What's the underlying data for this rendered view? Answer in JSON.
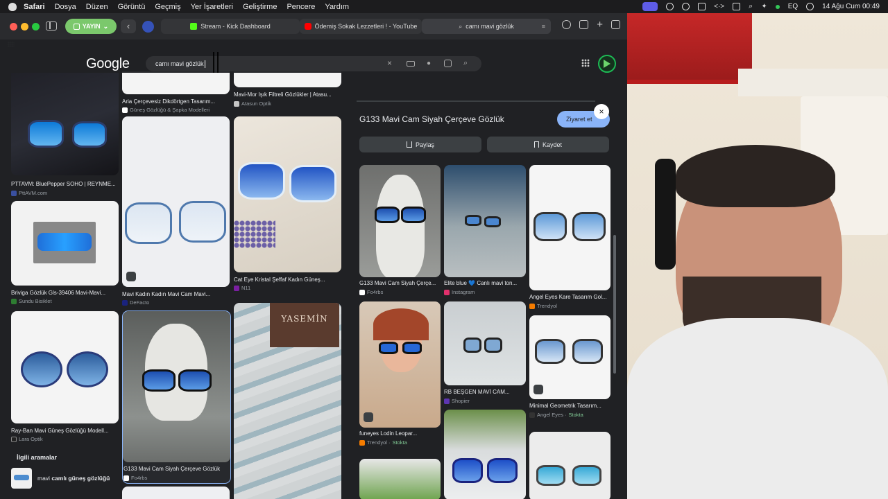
{
  "menubar": {
    "app": "Safari",
    "items": [
      "Dosya",
      "Düzen",
      "Görüntü",
      "Geçmiş",
      "Yer İşaretleri",
      "Geliştirme",
      "Pencere",
      "Yardım"
    ],
    "status": {
      "eq": "EQ",
      "datetime": "14 Ağu Cum  00:49"
    }
  },
  "toolbar": {
    "live_label": "YAYIN",
    "tabs": [
      {
        "label": "Stream - Kick Dashboard",
        "favicon_color": "#53fc18"
      },
      {
        "label": "Ödemiş Sokak Lezzetleri ! - YouTube",
        "favicon_color": "#ff0000"
      },
      {
        "label": "camı mavi gözlük",
        "favicon_color": "#aaaaaa"
      }
    ]
  },
  "google": {
    "logo": "Google",
    "query": "camı mavi gözlük"
  },
  "results": {
    "col1": [
      {
        "title": "PTTAVM: BluePepper SOHO | REYNME...",
        "source": "PttAVM.com"
      },
      {
        "title": "Briviga Gözlük Gls-39406 Mavi-Mavi...",
        "source": "Sundu Bisiklet"
      },
      {
        "title": "Ray-Ban Mavi Güneş Gözlüğü Modell...",
        "source": "Lara Optik"
      }
    ],
    "col2": [
      {
        "title": "Aria Çerçevesiz Dikdörtgen Tasarım...",
        "source": "Güneş Gözlüğü & Şapka Modelleri"
      },
      {
        "title": "Mavi Kadın Kadın Mavi Cam Mavi...",
        "source": "DeFacto"
      },
      {
        "title": "G133 Mavi Cam Siyah Çerçeve Gözlük",
        "source": "Fo4rbs"
      }
    ],
    "col3": [
      {
        "title": "Mavi-Mor Işık Filtreli Gözlükler | Atasu...",
        "source": "Atasun Optik"
      },
      {
        "title": "Cat Eye Kristal Şeffaf Kadın Güneş...",
        "source": "N11"
      },
      {
        "title": "",
        "source": ""
      }
    ],
    "related": {
      "heading": "İlgili aramalar",
      "items": [
        {
          "pre": "mavi ",
          "bold": "camlı güneş gözlüğü"
        }
      ]
    },
    "watermark": "YASEMİN"
  },
  "panel": {
    "title": "G133 Mavi Cam Siyah Çerçeve Gözlük",
    "visit_label": "Ziyaret et",
    "close": "×",
    "share_label": "Paylaş",
    "save_label": "Kaydet",
    "items": [
      {
        "title": "G133 Mavi Cam Siyah Çerçe...",
        "source": "Fo4rbs",
        "stock": ""
      },
      {
        "title": "Elite blue 💙 Canlı mavi ton...",
        "source": "Instagram",
        "stock": ""
      },
      {
        "title": "Angel Eyes Kare Tasarım Gol...",
        "source": "Trendyol",
        "stock": ""
      },
      {
        "title": "funeyes Lodin Leopar...",
        "source": "Trendyol · ",
        "stock": "Stokta"
      },
      {
        "title": "RB BEŞGEN MAVİ CAM...",
        "source": "Shopier",
        "stock": ""
      },
      {
        "title": "Minimal Geometrik Tasarım...",
        "source": "Angel Eyes · ",
        "stock": "Stokta"
      }
    ]
  }
}
